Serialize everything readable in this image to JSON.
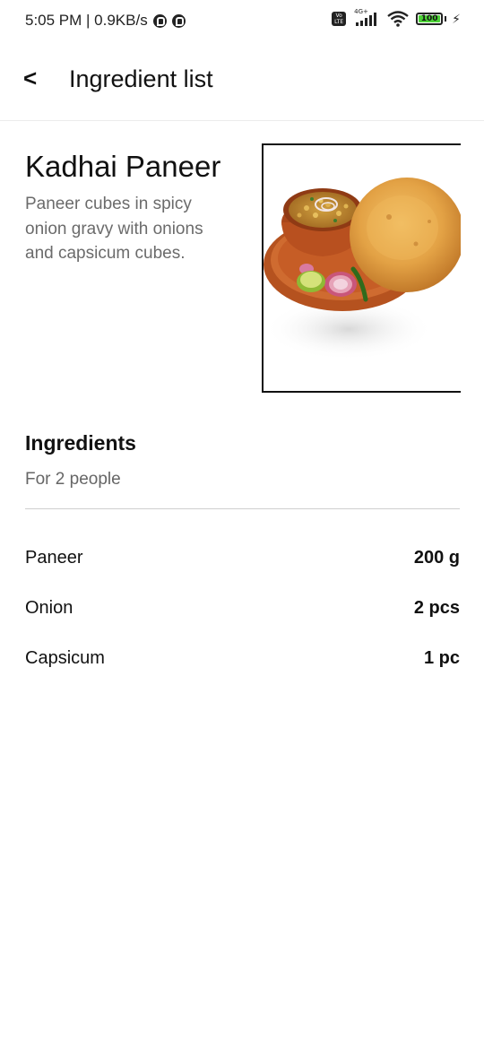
{
  "status_bar": {
    "time_speed": "5:05 PM | 0.9KB/s",
    "volte": "Vo LTE",
    "network": "4G+",
    "battery": "100"
  },
  "header": {
    "back_icon": "<",
    "title": "Ingredient list"
  },
  "dish": {
    "name": "Kadhai Paneer",
    "description": "Paneer cubes in spicy onion gravy with onions and capsicum cubes.",
    "image_icon": "dish-photo-chole-bhature"
  },
  "ingredients": {
    "title": "Ingredients",
    "servings": "For 2 people",
    "items": [
      {
        "name": "Paneer",
        "quantity": "200 g"
      },
      {
        "name": "Onion",
        "quantity": "2 pcs"
      },
      {
        "name": "Capsicum",
        "quantity": "1 pc"
      }
    ]
  },
  "colors": {
    "background": "#ffffff",
    "text_primary": "#111111",
    "text_secondary": "#6b6b6b",
    "battery_fill": "#4cd137"
  }
}
